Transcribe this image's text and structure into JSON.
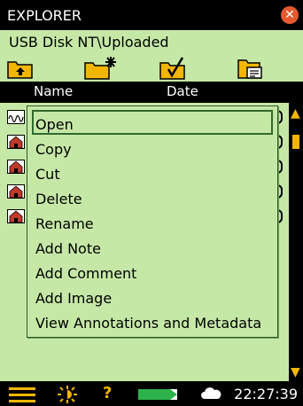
{
  "title": "EXPLORER",
  "path": "USB Disk NT\\Uploaded",
  "columns": {
    "name": "Name",
    "date": "Date"
  },
  "context_menu": {
    "items": [
      "Open",
      "Copy",
      "Cut",
      "Delete",
      "Rename",
      "Add Note",
      "Add Comment",
      "Add Image",
      "View Annotations and Metadata"
    ],
    "selected_index": 0
  },
  "status": {
    "time": "22:27:39"
  },
  "colors": {
    "panel_bg": "#c6e8a7",
    "accent_yellow": "#f3b600",
    "close_red": "#e35a2e",
    "dark_green": "#2f6a2c"
  },
  "icons": {
    "toolbar": [
      "folder-up-icon",
      "new-folder-icon",
      "select-folder-icon",
      "folder-properties-icon"
    ],
    "rows": [
      "waveform-file-icon",
      "house-file-icon",
      "house-file-icon",
      "house-file-icon",
      "house-file-icon"
    ],
    "status": [
      "menu-icon",
      "brightness-icon",
      "help-icon",
      "battery-icon",
      "cloud-icon"
    ]
  }
}
